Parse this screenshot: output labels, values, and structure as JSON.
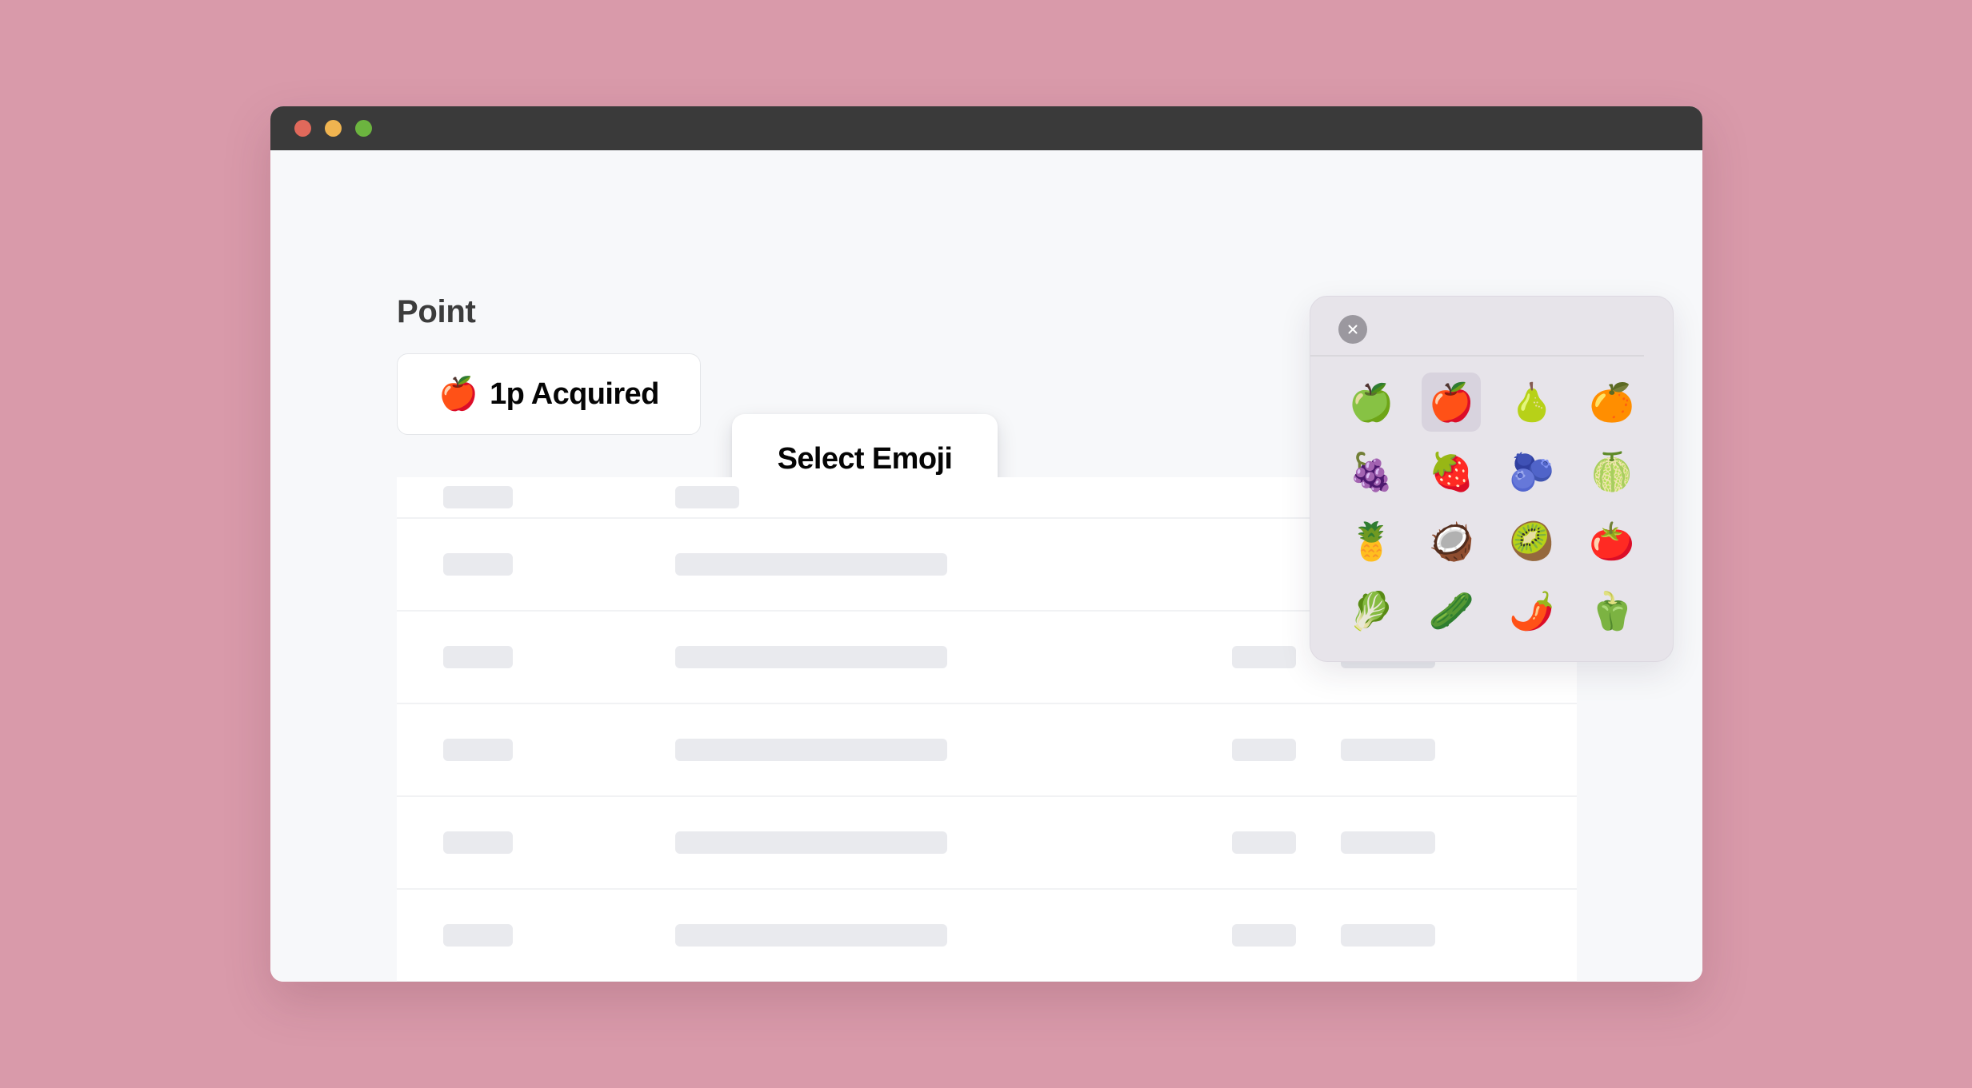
{
  "window": {
    "traffic_lights": [
      {
        "name": "close",
        "color": "#e0695b"
      },
      {
        "name": "minimize",
        "color": "#f0b450"
      },
      {
        "name": "maximize",
        "color": "#6cb43f"
      }
    ]
  },
  "page": {
    "title": "Point"
  },
  "acquired_button": {
    "emoji": "🍎",
    "label": "1p Acquired"
  },
  "select_emoji_button": {
    "label": "Select Emoji"
  },
  "emoji_picker": {
    "close_label": "×",
    "selected_index": 1,
    "emojis": [
      {
        "char": "🍏",
        "name": "green-apple"
      },
      {
        "char": "🍎",
        "name": "red-apple"
      },
      {
        "char": "🍐",
        "name": "pear"
      },
      {
        "char": "🍊",
        "name": "tangerine"
      },
      {
        "char": "🍇",
        "name": "grapes"
      },
      {
        "char": "🍓",
        "name": "strawberry"
      },
      {
        "char": "🫐",
        "name": "blueberries"
      },
      {
        "char": "🍈",
        "name": "melon"
      },
      {
        "char": "🍍",
        "name": "pineapple"
      },
      {
        "char": "🥥",
        "name": "coconut"
      },
      {
        "char": "🥝",
        "name": "kiwi-fruit"
      },
      {
        "char": "🍅",
        "name": "tomato"
      },
      {
        "char": "🥬",
        "name": "leafy-green"
      },
      {
        "char": "🥒",
        "name": "cucumber"
      },
      {
        "char": "🌶️",
        "name": "hot-pepper"
      },
      {
        "char": "🫑",
        "name": "bell-pepper"
      }
    ]
  },
  "table": {
    "rows": [
      {
        "type": "header",
        "cells": [
          "sm",
          null,
          "md",
          null
        ]
      },
      {
        "type": "data",
        "cells": [
          "sm",
          "lg",
          null,
          null
        ]
      },
      {
        "type": "data",
        "cells": [
          "sm",
          "lg",
          "md",
          "xl"
        ]
      },
      {
        "type": "data",
        "cells": [
          "sm",
          "lg",
          "md",
          "xl"
        ]
      },
      {
        "type": "data",
        "cells": [
          "sm",
          "lg",
          "md",
          "xl"
        ]
      },
      {
        "type": "data",
        "cells": [
          "sm",
          "lg",
          "md",
          "xl"
        ]
      }
    ]
  },
  "colors": {
    "page_background": "#d99aaa",
    "window_chrome": "#3a3a3a",
    "window_body": "#f7f8fa",
    "panel_background": "#e7e4ea",
    "skeleton": "#e9eaee",
    "selected_cell": "#d8d3de"
  }
}
